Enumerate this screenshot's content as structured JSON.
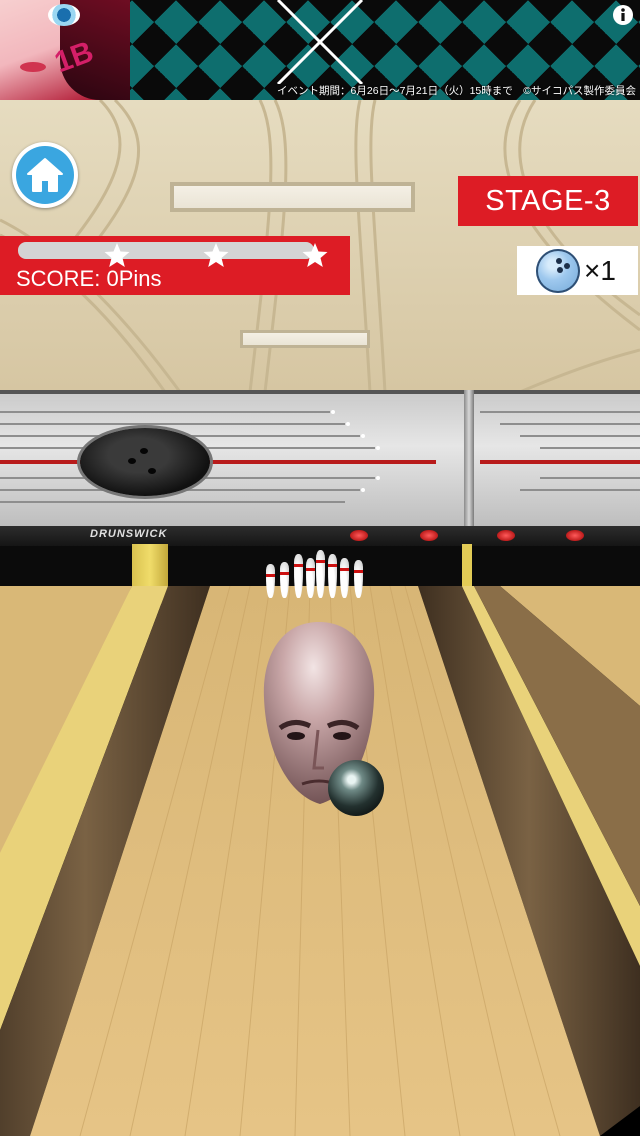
{
  "banner": {
    "notice": "イベント期間：6月26日〜7月21日（火）15時まで　©サイコパス製作委員会",
    "portrait_mark": "1B",
    "info_icon": "info-icon"
  },
  "hud": {
    "home_icon": "home-icon",
    "stage_label": "STAGE-3",
    "score_label": "SCORE: 0Pins",
    "progress_fraction": 0,
    "stars": [
      "star-icon",
      "star-icon",
      "star-icon"
    ],
    "balls_left": "×1",
    "ball_icon": "bowling-ball-icon"
  },
  "scene": {
    "brand_text": "DRUNSWICK",
    "pins_standing": 10
  },
  "colors": {
    "hud_red": "#dd1c25",
    "home_blue": "#3aa6e0",
    "lane_wood": "#e2bf7a",
    "gutter": "#5a4630"
  }
}
